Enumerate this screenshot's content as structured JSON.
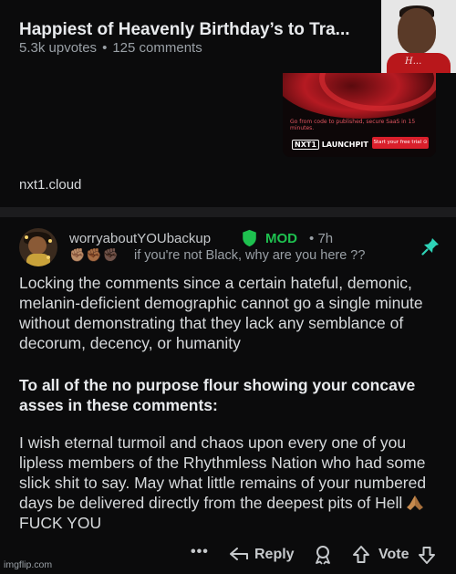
{
  "post": {
    "title": "Happiest of Heavenly Birthday’s to Tra...",
    "upvotes": "5.3k upvotes",
    "separator": "•",
    "comments": "125 comments",
    "thumbnail_shirt_text": "H..."
  },
  "ad": {
    "tagline": "Go from code to published, secure SaaS in 15 minutes.",
    "logo_box": "NXT1",
    "logo_text": "LAUNCHPIT",
    "cta": "Start your free trial ⊙",
    "domain": "nxt1.cloud"
  },
  "comment": {
    "username": "worryaboutYOUbackup",
    "mod_badge": "MOD",
    "separator": "•",
    "time": "7h",
    "flair_fists": "✊🏽✊🏾✊🏿",
    "flair_text": "if you're not Black, why are you here ??",
    "paragraph1": "Locking the comments since a certain hateful, demonic, melanin-deficient demographic cannot go a single minute without demonstrating that they lack any semblance of decorum, decency, or humanity",
    "paragraph2": "To all of the no purpose flour showing your concave asses in these comments:",
    "paragraph3_part1": "I wish eternal turmoil and chaos upon every one of you lipless members of the Rhythmless Nation who had some slick shit to say. May what little remains of your numbered days be delivered directly from the deepest pits of Hell",
    "paragraph3_part2": "FUCK YOU"
  },
  "actions": {
    "more": "•••",
    "reply": "Reply",
    "vote": "Vote"
  },
  "watermark": "imgflip.com",
  "colors": {
    "background": "#0b0b0c",
    "mod_green": "#1ec14f",
    "pin_teal": "#2ed3b7",
    "text": "#d7dadc",
    "muted": "#9aa0a6"
  },
  "icons": [
    "shield-icon",
    "pin-icon",
    "praying-hands-icon",
    "more-icon",
    "reply-icon",
    "award-icon",
    "upvote-icon",
    "downvote-icon"
  ]
}
